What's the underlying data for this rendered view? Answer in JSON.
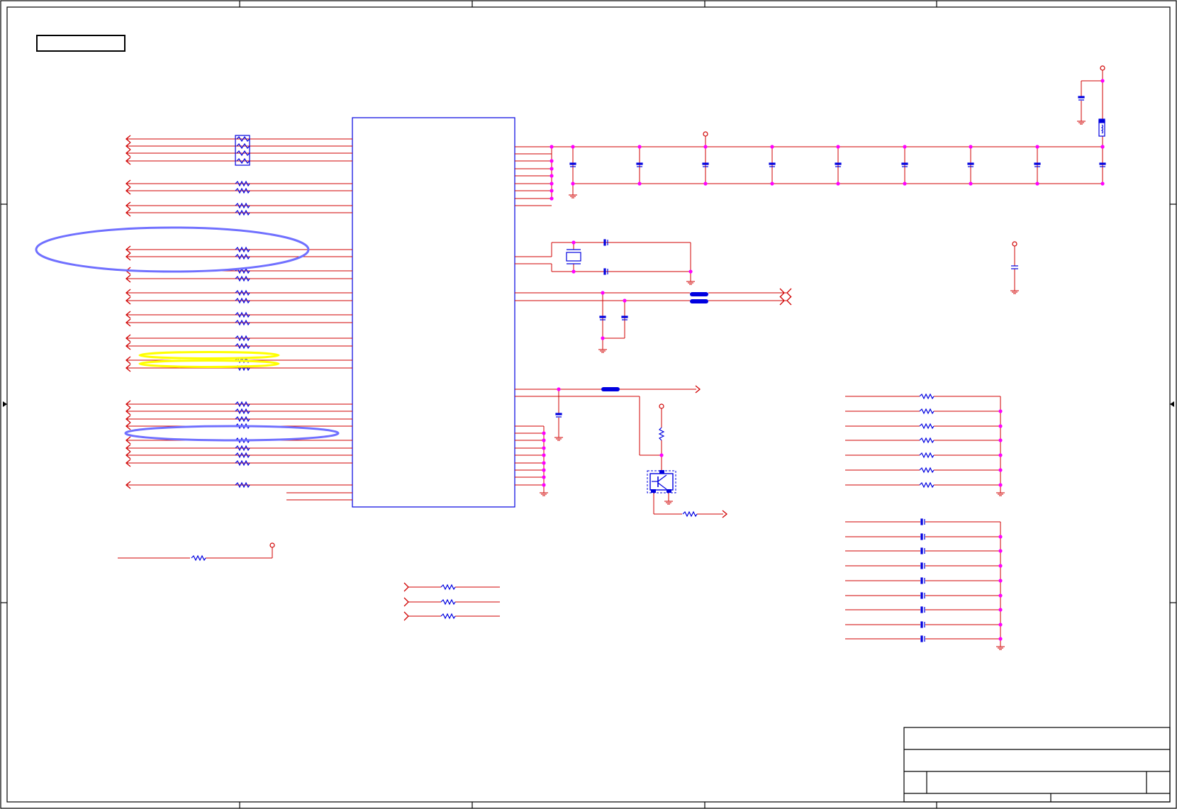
{
  "colors": {
    "wire": "#d00000",
    "part": "#0000e0",
    "junction": "#ff00ff",
    "border": "#000000",
    "highlight_blue": "#7070ff",
    "highlight_yellow": "#ffff00"
  },
  "annotations": {
    "blue_ellipses": 2,
    "yellow_ellipses": 2
  }
}
